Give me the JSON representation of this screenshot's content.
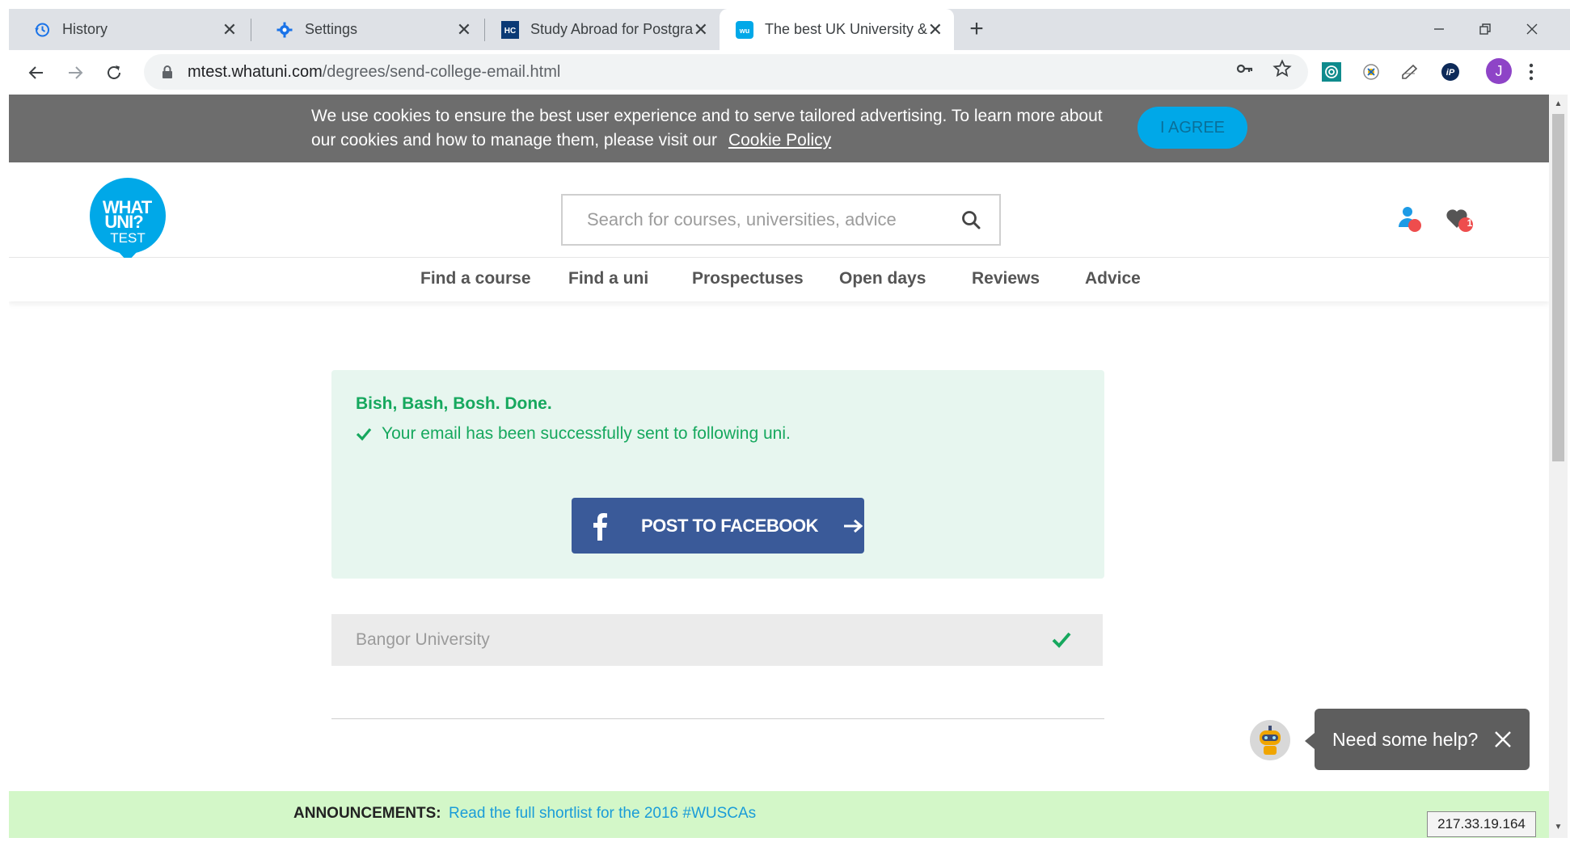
{
  "browser": {
    "tabs": [
      {
        "title": "History",
        "icon": "history-icon"
      },
      {
        "title": "Settings",
        "icon": "gear-icon"
      },
      {
        "title": "Study Abroad for Postgraduate a",
        "icon": "hc-favicon"
      },
      {
        "title": "The best UK University & degree",
        "icon": "whatuni-favicon",
        "active": true
      }
    ],
    "new_tab": "+",
    "url_host": "mtest.whatuni.com",
    "url_path": "/degrees/send-college-email.html",
    "profile_initial": "J",
    "profile_color": "#8e44c7"
  },
  "cookie_banner": {
    "text": "We use cookies to ensure the best user experience and to serve tailored advertising. To learn more about our cookies and how to manage them, please visit our",
    "link": "Cookie Policy",
    "button": "I AGREE"
  },
  "header": {
    "logo_line1": "WHAT",
    "logo_line2": "UNI?",
    "logo_line3": "TEST",
    "search_placeholder": "Search for courses, universities, advice",
    "shortlist_count": "1"
  },
  "nav": {
    "items": [
      "Find a course",
      "Find a uni",
      "Prospectuses",
      "Open days",
      "Reviews",
      "Advice"
    ]
  },
  "success": {
    "headline": "Bish, Bash, Bosh. Done.",
    "message": "Your email has been successfully sent to following uni.",
    "facebook_button": "POST TO FACEBOOK"
  },
  "university": {
    "name": "Bangor University"
  },
  "help": {
    "label": "Need some help?"
  },
  "announcements": {
    "label": "ANNOUNCEMENTS:",
    "link": "Read the full shortlist for the 2016 #WUSCAs"
  },
  "ip_address": "217.33.19.164",
  "colors": {
    "brand": "#00a8e8",
    "success_text": "#16a85e",
    "success_bg": "#e7f6ef",
    "facebook": "#3a5a99",
    "announce_bg": "#d3f7c8"
  }
}
